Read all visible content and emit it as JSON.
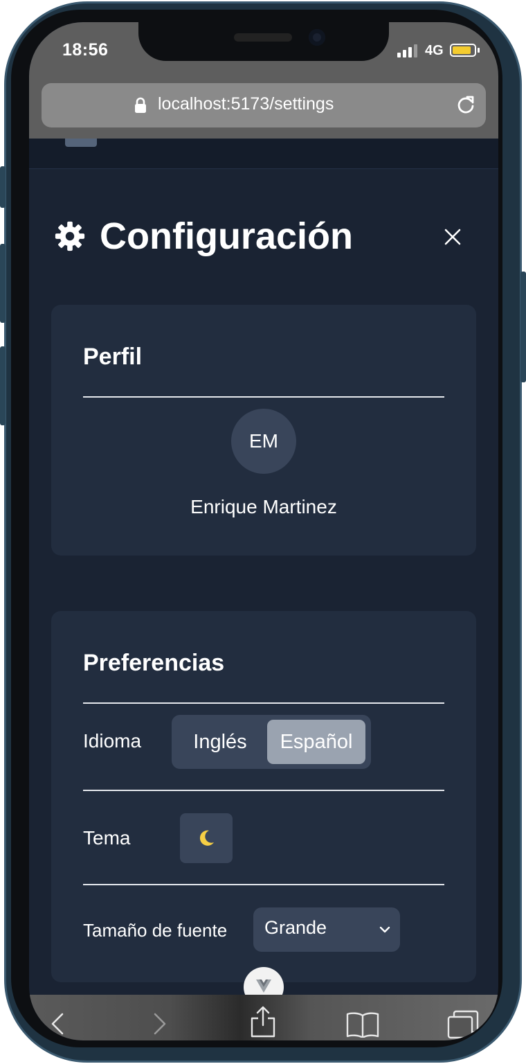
{
  "status_bar": {
    "time": "18:56",
    "network": "4G",
    "battery_level": 0.85,
    "battery_color": "#f4cc2f"
  },
  "browser": {
    "url": "localhost:5173/settings",
    "icons": [
      "lock-icon",
      "reload-icon",
      "back-icon",
      "forward-icon",
      "share-icon",
      "bookmarks-icon",
      "tabs-icon"
    ]
  },
  "page": {
    "title": "Configuración",
    "title_icon": "gear-icon",
    "close_icon": "close-icon"
  },
  "profile": {
    "heading": "Perfil",
    "initials": "EM",
    "name": "Enrique Martinez"
  },
  "preferences": {
    "heading": "Preferencias",
    "language": {
      "label": "Idioma",
      "options": [
        "Inglés",
        "Español"
      ],
      "selected": "Español"
    },
    "theme": {
      "label": "Tema",
      "icon": "moon-icon",
      "glyph": "🌙"
    },
    "font_size": {
      "label": "Tamaño de fuente",
      "value": "Grande"
    }
  },
  "colors": {
    "background": "#1a2333",
    "card": "#222d3f",
    "control": "#39455a",
    "selected_option": "#9aa3b0",
    "text": "#ffffff"
  }
}
